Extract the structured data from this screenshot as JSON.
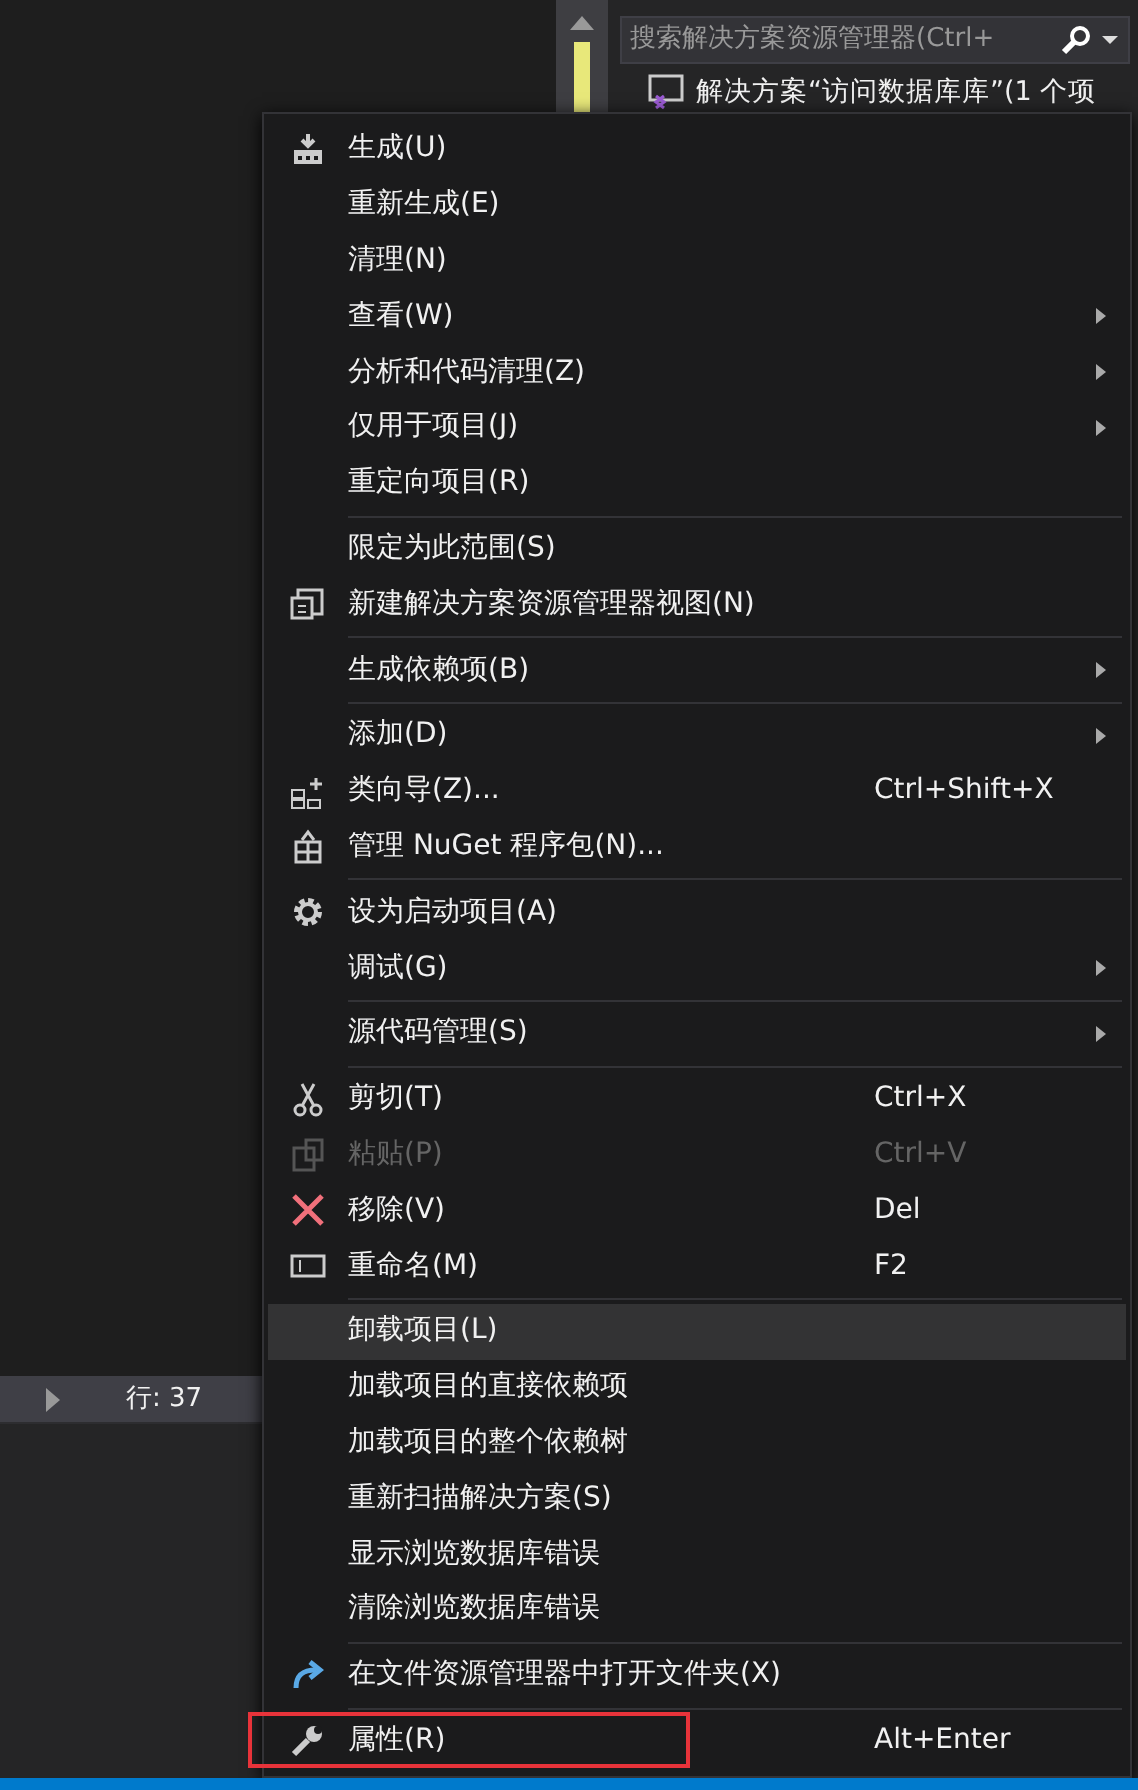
{
  "search": {
    "placeholder": "搜索解决方案资源管理器(Ctrl+"
  },
  "tree": [
    {
      "label": "解决方案“访问数据库库”(1 个项"
    }
  ],
  "status_bar": {
    "line": "行: 37"
  },
  "context_menu": {
    "groups": [
      [
        {
          "label": "生成(U)",
          "kind": "build",
          "submenu": false,
          "disabled": false,
          "selected": false,
          "annotated": false
        },
        {
          "label": "重新生成(E)",
          "submenu": false,
          "disabled": false,
          "selected": false,
          "annotated": false
        },
        {
          "label": "清理(N)",
          "submenu": false,
          "disabled": false,
          "selected": false,
          "annotated": false
        },
        {
          "label": "查看(W)",
          "submenu": true,
          "disabled": false,
          "selected": false,
          "annotated": false
        },
        {
          "label": "分析和代码清理(Z)",
          "submenu": true,
          "disabled": false,
          "selected": false,
          "annotated": false
        },
        {
          "label": "仅用于项目(J)",
          "submenu": true,
          "disabled": false,
          "selected": false,
          "annotated": false
        },
        {
          "label": "重定向项目(R)",
          "submenu": false,
          "disabled": false,
          "selected": false,
          "annotated": false
        }
      ],
      [
        {
          "label": "限定为此范围(S)",
          "submenu": false,
          "disabled": false,
          "selected": false,
          "annotated": false
        },
        {
          "label": "新建解决方案资源管理器视图(N)",
          "kind": "newview",
          "submenu": false,
          "disabled": false,
          "selected": false,
          "annotated": false
        }
      ],
      [
        {
          "label": "生成依赖项(B)",
          "submenu": true,
          "disabled": false,
          "selected": false,
          "annotated": false
        }
      ],
      [
        {
          "label": "添加(D)",
          "submenu": true,
          "disabled": false,
          "selected": false,
          "annotated": false
        },
        {
          "label": "类向导(Z)...",
          "kind": "wizard",
          "shortcut": "Ctrl+Shift+X",
          "submenu": false,
          "disabled": false,
          "selected": false,
          "annotated": false
        },
        {
          "label": "管理 NuGet 程序包(N)...",
          "kind": "package",
          "submenu": false,
          "disabled": false,
          "selected": false,
          "annotated": false
        }
      ],
      [
        {
          "label": "设为启动项目(A)",
          "kind": "gear",
          "submenu": false,
          "disabled": false,
          "selected": false,
          "annotated": false
        },
        {
          "label": "调试(G)",
          "submenu": true,
          "disabled": false,
          "selected": false,
          "annotated": false
        }
      ],
      [
        {
          "label": "源代码管理(S)",
          "submenu": true,
          "disabled": false,
          "selected": false,
          "annotated": false
        }
      ],
      [
        {
          "label": "剪切(T)",
          "kind": "cut",
          "shortcut": "Ctrl+X",
          "submenu": false,
          "disabled": false,
          "selected": false,
          "annotated": false
        },
        {
          "label": "粘贴(P)",
          "kind": "paste",
          "shortcut": "Ctrl+V",
          "submenu": false,
          "disabled": true,
          "selected": false,
          "annotated": false
        },
        {
          "label": "移除(V)",
          "kind": "remove",
          "shortcut": "Del",
          "submenu": false,
          "disabled": false,
          "selected": false,
          "annotated": false
        },
        {
          "label": "重命名(M)",
          "kind": "rename",
          "shortcut": "F2",
          "submenu": false,
          "disabled": false,
          "selected": false,
          "annotated": false
        }
      ],
      [
        {
          "label": "卸载项目(L)",
          "submenu": false,
          "disabled": false,
          "selected": true,
          "annotated": false
        },
        {
          "label": "加载项目的直接依赖项",
          "submenu": false,
          "disabled": false,
          "selected": false,
          "annotated": false
        },
        {
          "label": "加载项目的整个依赖树",
          "submenu": false,
          "disabled": false,
          "selected": false,
          "annotated": false
        },
        {
          "label": "重新扫描解决方案(S)",
          "submenu": false,
          "disabled": false,
          "selected": false,
          "annotated": false
        },
        {
          "label": "显示浏览数据库错误",
          "submenu": false,
          "disabled": false,
          "selected": false,
          "annotated": false
        },
        {
          "label": "清除浏览数据库错误",
          "submenu": false,
          "disabled": false,
          "selected": false,
          "annotated": false
        }
      ],
      [
        {
          "label": "在文件资源管理器中打开文件夹(X)",
          "kind": "open",
          "submenu": false,
          "disabled": false,
          "selected": false,
          "annotated": false
        }
      ],
      [
        {
          "label": "属性(R)",
          "kind": "wrench",
          "shortcut": "Alt+Enter",
          "submenu": false,
          "disabled": false,
          "selected": false,
          "annotated": true
        }
      ]
    ]
  }
}
